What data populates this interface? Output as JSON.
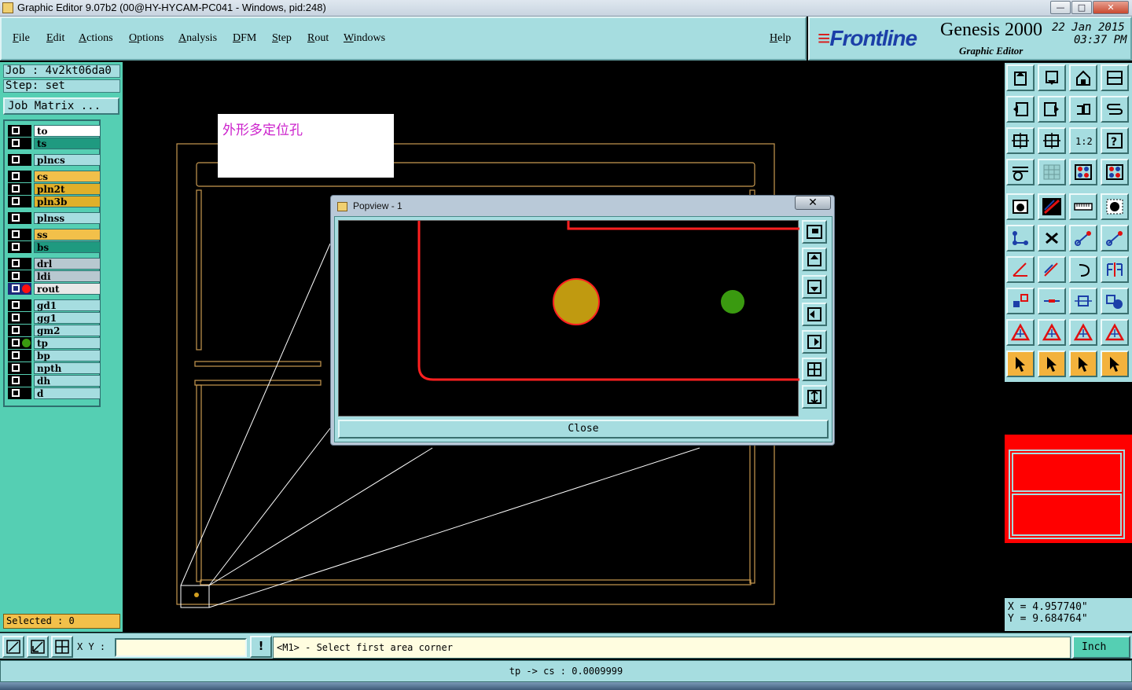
{
  "window": {
    "title": "Graphic Editor 9.07b2 (00@HY-HYCAM-PC041 - Windows, pid:248)",
    "minimize": "—",
    "maximize": "□",
    "close": "✕"
  },
  "menu": {
    "items": [
      "File",
      "Edit",
      "Actions",
      "Options",
      "Analysis",
      "DFM",
      "Step",
      "Rout",
      "Windows"
    ],
    "help": "Help"
  },
  "brand": {
    "logo_mark": "≡",
    "logo": "Frontline",
    "product": "Genesis 2000",
    "subtitle": "Graphic Editor",
    "date": "22 Jan 2015",
    "time": "03:37 PM"
  },
  "job": {
    "job_label": "Job : 4v2kt06da0",
    "step_label": "Step: set",
    "matrix_button": "Job Matrix ..."
  },
  "layers": [
    {
      "name": "to",
      "color": "#ffffff",
      "dot": ""
    },
    {
      "name": "ts",
      "color": "#1f9a80",
      "dot": ""
    },
    {
      "name": "plncs",
      "color": "#a6dde0",
      "dot": ""
    },
    {
      "name": "cs",
      "color": "#f2c04a",
      "dot": ""
    },
    {
      "name": "pln2t",
      "color": "#e0b02a",
      "dot": ""
    },
    {
      "name": "pln3b",
      "color": "#e0b02a",
      "dot": ""
    },
    {
      "name": "plnss",
      "color": "#a6dde0",
      "dot": ""
    },
    {
      "name": "ss",
      "color": "#f2c04a",
      "dot": ""
    },
    {
      "name": "bs",
      "color": "#1f9a80",
      "dot": ""
    },
    {
      "name": "drl",
      "color": "#b8c8d0",
      "dot": ""
    },
    {
      "name": "ldi",
      "color": "#b8c8d0",
      "dot": ""
    },
    {
      "name": "rout",
      "color": "#e8e8e8",
      "dot": "#ff1010"
    },
    {
      "name": "gd1",
      "color": "#a6dde0",
      "dot": ""
    },
    {
      "name": "gg1",
      "color": "#a6dde0",
      "dot": ""
    },
    {
      "name": "gm2",
      "color": "#a6dde0",
      "dot": ""
    },
    {
      "name": "tp",
      "color": "#a6dde0",
      "dot": "#3a9a10"
    },
    {
      "name": "bp",
      "color": "#a6dde0",
      "dot": ""
    },
    {
      "name": "npth",
      "color": "#a6dde0",
      "dot": ""
    },
    {
      "name": "dh",
      "color": "#a6dde0",
      "dot": ""
    },
    {
      "name": "d",
      "color": "#a6dde0",
      "dot": ""
    }
  ],
  "selected": "Selected : 0",
  "canvas_note": "外形多定位孔",
  "popview": {
    "title": "Popview - 1",
    "close_x": "✕",
    "close_button": "Close"
  },
  "coords": {
    "x": "X = 4.957740\"",
    "y": "Y = 9.684764\""
  },
  "command": {
    "xy_label": "X Y :",
    "xy_value": "",
    "warn": "!",
    "prompt": "<M1> - Select first area corner",
    "units": "Inch"
  },
  "status": "tp -> cs : 0.0009999"
}
